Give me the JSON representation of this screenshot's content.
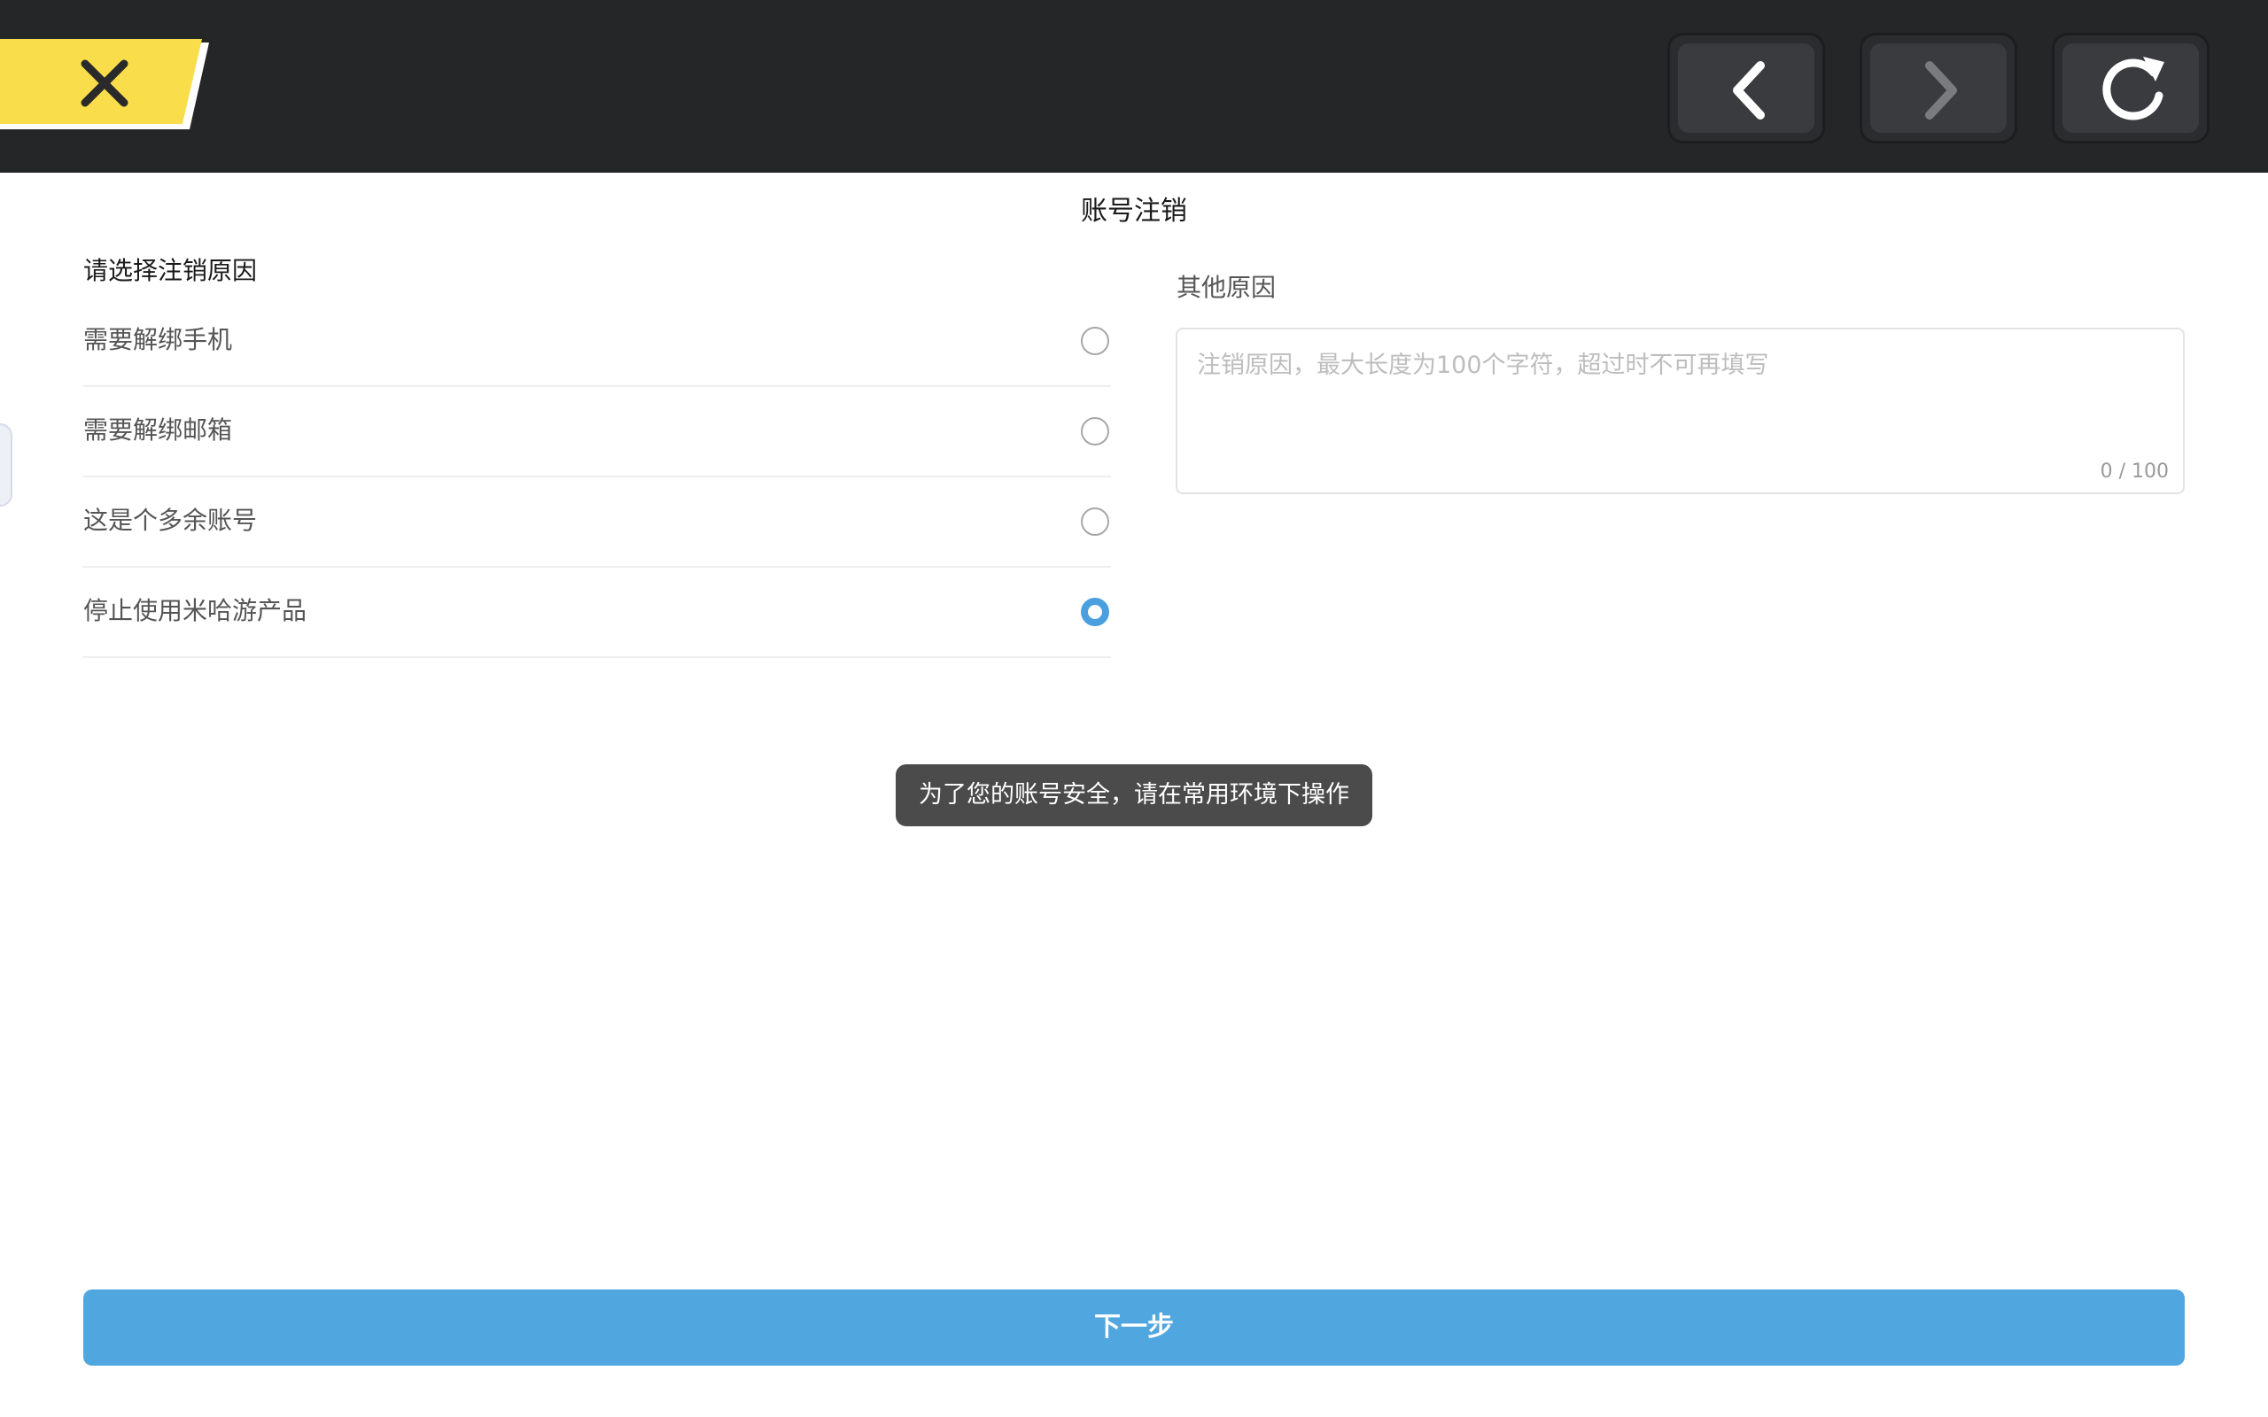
{
  "toolbar": {
    "close_icon": "close-icon",
    "back_icon": "chevron-left-icon",
    "forward_icon": "chevron-right-icon",
    "refresh_icon": "refresh-icon",
    "close_color": "#f9dd4a",
    "bar_color": "#252628"
  },
  "page": {
    "title": "账号注销",
    "section_label": "请选择注销原因"
  },
  "reasons": {
    "items": [
      {
        "label": "需要解绑手机",
        "selected": false
      },
      {
        "label": "需要解绑邮箱",
        "selected": false
      },
      {
        "label": "这是个多余账号",
        "selected": false
      },
      {
        "label": "停止使用米哈游产品",
        "selected": true
      }
    ],
    "accent_color": "#4a9fde"
  },
  "other_reason": {
    "label": "其他原因",
    "placeholder": "注销原因，最大长度为100个字符，超过时不可再填写",
    "value": "",
    "counter": "0 / 100"
  },
  "toast": {
    "text": "为了您的账号安全，请在常用环境下操作"
  },
  "next_button": {
    "label": "下一步",
    "color": "#50a6df"
  }
}
